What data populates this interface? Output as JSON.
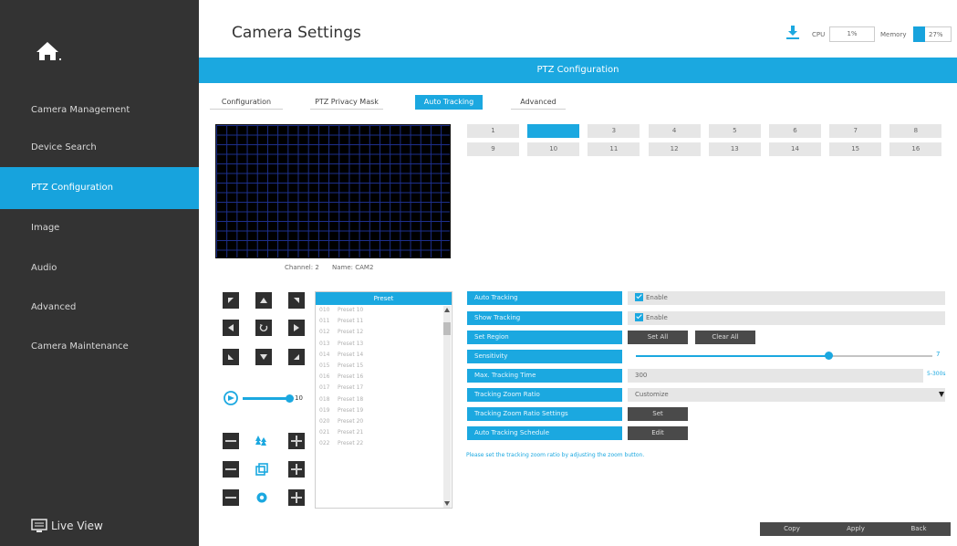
{
  "sidebar": {
    "items": [
      {
        "label": "Camera Management"
      },
      {
        "label": "Device Search"
      },
      {
        "label": "PTZ Configuration"
      },
      {
        "label": "Image"
      },
      {
        "label": "Audio"
      },
      {
        "label": "Advanced"
      },
      {
        "label": "Camera Maintenance"
      }
    ],
    "active": "PTZ Configuration",
    "live_view": "Live View"
  },
  "header": {
    "title": "Camera Settings",
    "cpu_label": "CPU",
    "cpu_value": "1%",
    "memory_label": "Memory",
    "memory_value": "27%",
    "memory_percent": 27
  },
  "section_title": "PTZ Configuration",
  "tabs": [
    {
      "label": "Configuration"
    },
    {
      "label": "PTZ Privacy Mask"
    },
    {
      "label": "Auto Tracking"
    },
    {
      "label": "Advanced"
    }
  ],
  "active_tab": "Auto Tracking",
  "channel_info": {
    "channel": "Channel: 2",
    "name": "Name: CAM2"
  },
  "channels": [
    "1",
    "2",
    "3",
    "4",
    "5",
    "6",
    "7",
    "8",
    "9",
    "10",
    "11",
    "12",
    "13",
    "14",
    "15",
    "16"
  ],
  "selected_channel": "2",
  "ptz": {
    "speed_value": "10",
    "speed": 10
  },
  "preset": {
    "header": "Preset",
    "rows": [
      {
        "num": "010",
        "name": "Preset 10"
      },
      {
        "num": "011",
        "name": "Preset 11"
      },
      {
        "num": "012",
        "name": "Preset 12"
      },
      {
        "num": "013",
        "name": "Preset 13"
      },
      {
        "num": "014",
        "name": "Preset 14"
      },
      {
        "num": "015",
        "name": "Preset 15"
      },
      {
        "num": "016",
        "name": "Preset 16"
      },
      {
        "num": "017",
        "name": "Preset 17"
      },
      {
        "num": "018",
        "name": "Preset 18"
      },
      {
        "num": "019",
        "name": "Preset 19"
      },
      {
        "num": "020",
        "name": "Preset 20"
      },
      {
        "num": "021",
        "name": "Preset 21"
      },
      {
        "num": "022",
        "name": "Preset 22"
      }
    ]
  },
  "settings": {
    "auto_tracking": {
      "label": "Auto Tracking",
      "value": "Enable",
      "checked": true
    },
    "show_tracking": {
      "label": "Show Tracking",
      "value": "Enable",
      "checked": true
    },
    "set_region": {
      "label": "Set Region",
      "set_all": "Set All",
      "clear_all": "Clear All"
    },
    "sensitivity": {
      "label": "Sensitivity",
      "value": "7",
      "max": 10
    },
    "max_tracking_time": {
      "label": "Max. Tracking Time",
      "value": "300",
      "range": "5-300s"
    },
    "tracking_zoom_ratio": {
      "label": "Tracking Zoom Ratio",
      "value": "Customize"
    },
    "tracking_zoom_ratio_settings": {
      "label": "Tracking Zoom Ratio Settings",
      "button": "Set"
    },
    "auto_tracking_schedule": {
      "label": "Auto Tracking Schedule",
      "button": "Edit"
    },
    "hint": "Please set the tracking zoom ratio by adjusting the zoom button."
  },
  "buttons": {
    "copy": "Copy",
    "apply": "Apply",
    "back": "Back"
  },
  "colors": {
    "accent": "#1ba8e0",
    "sidebar": "#333333"
  }
}
